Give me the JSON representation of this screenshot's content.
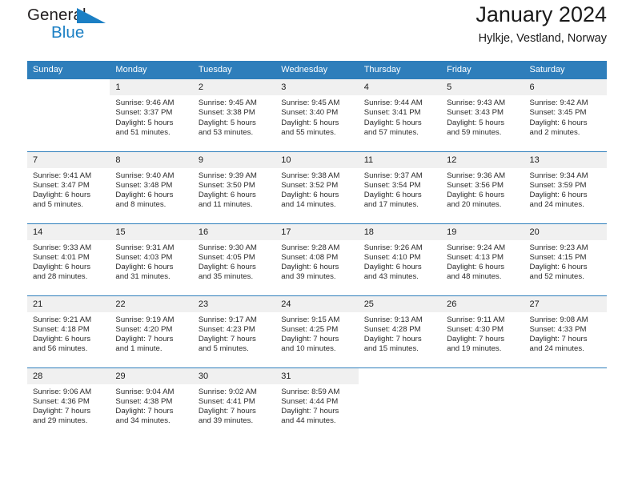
{
  "brand": {
    "line1": "General",
    "line2": "Blue",
    "triangle_icon": "triangle-icon",
    "accent_color": "#1b7fc4"
  },
  "header": {
    "title": "January 2024",
    "subtitle": "Hylkje, Vestland, Norway"
  },
  "theme": {
    "header_bg": "#2e7ebb",
    "header_text": "#ffffff",
    "daynum_bg": "#f0f0f0",
    "grid_line": "#2e7ebb"
  },
  "calendar": {
    "weekday_headers": [
      "Sunday",
      "Monday",
      "Tuesday",
      "Wednesday",
      "Thursday",
      "Friday",
      "Saturday"
    ],
    "weeks": [
      [
        {
          "day": "",
          "blank": true,
          "sunrise": "",
          "sunset": "",
          "daylight1": "",
          "daylight2": ""
        },
        {
          "day": "1",
          "sunrise": "Sunrise: 9:46 AM",
          "sunset": "Sunset: 3:37 PM",
          "daylight1": "Daylight: 5 hours",
          "daylight2": "and 51 minutes."
        },
        {
          "day": "2",
          "sunrise": "Sunrise: 9:45 AM",
          "sunset": "Sunset: 3:38 PM",
          "daylight1": "Daylight: 5 hours",
          "daylight2": "and 53 minutes."
        },
        {
          "day": "3",
          "sunrise": "Sunrise: 9:45 AM",
          "sunset": "Sunset: 3:40 PM",
          "daylight1": "Daylight: 5 hours",
          "daylight2": "and 55 minutes."
        },
        {
          "day": "4",
          "sunrise": "Sunrise: 9:44 AM",
          "sunset": "Sunset: 3:41 PM",
          "daylight1": "Daylight: 5 hours",
          "daylight2": "and 57 minutes."
        },
        {
          "day": "5",
          "sunrise": "Sunrise: 9:43 AM",
          "sunset": "Sunset: 3:43 PM",
          "daylight1": "Daylight: 5 hours",
          "daylight2": "and 59 minutes."
        },
        {
          "day": "6",
          "sunrise": "Sunrise: 9:42 AM",
          "sunset": "Sunset: 3:45 PM",
          "daylight1": "Daylight: 6 hours",
          "daylight2": "and 2 minutes."
        }
      ],
      [
        {
          "day": "7",
          "sunrise": "Sunrise: 9:41 AM",
          "sunset": "Sunset: 3:47 PM",
          "daylight1": "Daylight: 6 hours",
          "daylight2": "and 5 minutes."
        },
        {
          "day": "8",
          "sunrise": "Sunrise: 9:40 AM",
          "sunset": "Sunset: 3:48 PM",
          "daylight1": "Daylight: 6 hours",
          "daylight2": "and 8 minutes."
        },
        {
          "day": "9",
          "sunrise": "Sunrise: 9:39 AM",
          "sunset": "Sunset: 3:50 PM",
          "daylight1": "Daylight: 6 hours",
          "daylight2": "and 11 minutes."
        },
        {
          "day": "10",
          "sunrise": "Sunrise: 9:38 AM",
          "sunset": "Sunset: 3:52 PM",
          "daylight1": "Daylight: 6 hours",
          "daylight2": "and 14 minutes."
        },
        {
          "day": "11",
          "sunrise": "Sunrise: 9:37 AM",
          "sunset": "Sunset: 3:54 PM",
          "daylight1": "Daylight: 6 hours",
          "daylight2": "and 17 minutes."
        },
        {
          "day": "12",
          "sunrise": "Sunrise: 9:36 AM",
          "sunset": "Sunset: 3:56 PM",
          "daylight1": "Daylight: 6 hours",
          "daylight2": "and 20 minutes."
        },
        {
          "day": "13",
          "sunrise": "Sunrise: 9:34 AM",
          "sunset": "Sunset: 3:59 PM",
          "daylight1": "Daylight: 6 hours",
          "daylight2": "and 24 minutes."
        }
      ],
      [
        {
          "day": "14",
          "sunrise": "Sunrise: 9:33 AM",
          "sunset": "Sunset: 4:01 PM",
          "daylight1": "Daylight: 6 hours",
          "daylight2": "and 28 minutes."
        },
        {
          "day": "15",
          "sunrise": "Sunrise: 9:31 AM",
          "sunset": "Sunset: 4:03 PM",
          "daylight1": "Daylight: 6 hours",
          "daylight2": "and 31 minutes."
        },
        {
          "day": "16",
          "sunrise": "Sunrise: 9:30 AM",
          "sunset": "Sunset: 4:05 PM",
          "daylight1": "Daylight: 6 hours",
          "daylight2": "and 35 minutes."
        },
        {
          "day": "17",
          "sunrise": "Sunrise: 9:28 AM",
          "sunset": "Sunset: 4:08 PM",
          "daylight1": "Daylight: 6 hours",
          "daylight2": "and 39 minutes."
        },
        {
          "day": "18",
          "sunrise": "Sunrise: 9:26 AM",
          "sunset": "Sunset: 4:10 PM",
          "daylight1": "Daylight: 6 hours",
          "daylight2": "and 43 minutes."
        },
        {
          "day": "19",
          "sunrise": "Sunrise: 9:24 AM",
          "sunset": "Sunset: 4:13 PM",
          "daylight1": "Daylight: 6 hours",
          "daylight2": "and 48 minutes."
        },
        {
          "day": "20",
          "sunrise": "Sunrise: 9:23 AM",
          "sunset": "Sunset: 4:15 PM",
          "daylight1": "Daylight: 6 hours",
          "daylight2": "and 52 minutes."
        }
      ],
      [
        {
          "day": "21",
          "sunrise": "Sunrise: 9:21 AM",
          "sunset": "Sunset: 4:18 PM",
          "daylight1": "Daylight: 6 hours",
          "daylight2": "and 56 minutes."
        },
        {
          "day": "22",
          "sunrise": "Sunrise: 9:19 AM",
          "sunset": "Sunset: 4:20 PM",
          "daylight1": "Daylight: 7 hours",
          "daylight2": "and 1 minute."
        },
        {
          "day": "23",
          "sunrise": "Sunrise: 9:17 AM",
          "sunset": "Sunset: 4:23 PM",
          "daylight1": "Daylight: 7 hours",
          "daylight2": "and 5 minutes."
        },
        {
          "day": "24",
          "sunrise": "Sunrise: 9:15 AM",
          "sunset": "Sunset: 4:25 PM",
          "daylight1": "Daylight: 7 hours",
          "daylight2": "and 10 minutes."
        },
        {
          "day": "25",
          "sunrise": "Sunrise: 9:13 AM",
          "sunset": "Sunset: 4:28 PM",
          "daylight1": "Daylight: 7 hours",
          "daylight2": "and 15 minutes."
        },
        {
          "day": "26",
          "sunrise": "Sunrise: 9:11 AM",
          "sunset": "Sunset: 4:30 PM",
          "daylight1": "Daylight: 7 hours",
          "daylight2": "and 19 minutes."
        },
        {
          "day": "27",
          "sunrise": "Sunrise: 9:08 AM",
          "sunset": "Sunset: 4:33 PM",
          "daylight1": "Daylight: 7 hours",
          "daylight2": "and 24 minutes."
        }
      ],
      [
        {
          "day": "28",
          "sunrise": "Sunrise: 9:06 AM",
          "sunset": "Sunset: 4:36 PM",
          "daylight1": "Daylight: 7 hours",
          "daylight2": "and 29 minutes."
        },
        {
          "day": "29",
          "sunrise": "Sunrise: 9:04 AM",
          "sunset": "Sunset: 4:38 PM",
          "daylight1": "Daylight: 7 hours",
          "daylight2": "and 34 minutes."
        },
        {
          "day": "30",
          "sunrise": "Sunrise: 9:02 AM",
          "sunset": "Sunset: 4:41 PM",
          "daylight1": "Daylight: 7 hours",
          "daylight2": "and 39 minutes."
        },
        {
          "day": "31",
          "sunrise": "Sunrise: 8:59 AM",
          "sunset": "Sunset: 4:44 PM",
          "daylight1": "Daylight: 7 hours",
          "daylight2": "and 44 minutes."
        },
        {
          "day": "",
          "blank": true,
          "sunrise": "",
          "sunset": "",
          "daylight1": "",
          "daylight2": ""
        },
        {
          "day": "",
          "blank": true,
          "sunrise": "",
          "sunset": "",
          "daylight1": "",
          "daylight2": ""
        },
        {
          "day": "",
          "blank": true,
          "sunrise": "",
          "sunset": "",
          "daylight1": "",
          "daylight2": ""
        }
      ]
    ]
  }
}
